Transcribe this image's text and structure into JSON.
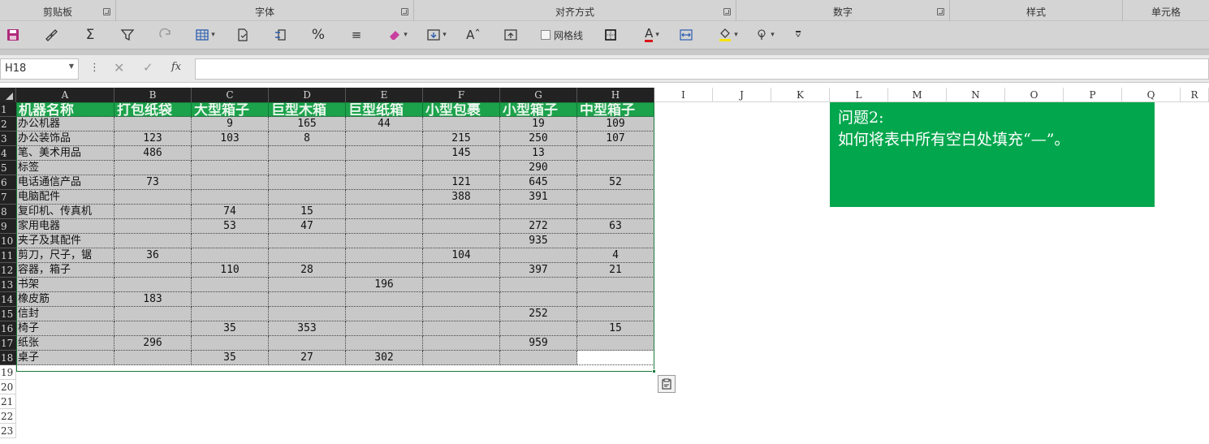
{
  "ribbon": {
    "groups": [
      {
        "label": "剪贴板"
      },
      {
        "label": "字体"
      },
      {
        "label": "对齐方式"
      },
      {
        "label": "数字"
      },
      {
        "label": "样式"
      },
      {
        "label": "单元格"
      }
    ],
    "toolbar": {
      "gridlines_label": "网格线"
    }
  },
  "formula_bar": {
    "name_box": "H18",
    "fx_label": "fx",
    "content": ""
  },
  "sheet": {
    "column_headers": [
      "A",
      "B",
      "C",
      "D",
      "E",
      "F",
      "G",
      "H",
      "I",
      "J",
      "K",
      "L",
      "M",
      "N",
      "O",
      "P",
      "Q",
      "R"
    ],
    "row_headers": [
      "1",
      "2",
      "3",
      "4",
      "5",
      "6",
      "7",
      "8",
      "9",
      "10",
      "11",
      "12",
      "13",
      "14",
      "15",
      "16",
      "17",
      "18",
      "19",
      "20",
      "21",
      "22",
      "23"
    ],
    "header_row": [
      "机器名称",
      "打包纸袋",
      "大型箱子",
      "巨型木箱",
      "巨型纸箱",
      "小型包裹",
      "小型箱子",
      "中型箱子"
    ],
    "rows": [
      [
        "办公机器",
        "",
        "9",
        "165",
        "44",
        "",
        "19",
        "109"
      ],
      [
        "办公装饰品",
        "123",
        "103",
        "8",
        "",
        "215",
        "250",
        "107"
      ],
      [
        "笔、美术用品",
        "486",
        "",
        "",
        "",
        "145",
        "13",
        ""
      ],
      [
        "标签",
        "",
        "",
        "",
        "",
        "",
        "290",
        ""
      ],
      [
        "电话通信产品",
        "73",
        "",
        "",
        "",
        "121",
        "645",
        "52"
      ],
      [
        "电脑配件",
        "",
        "",
        "",
        "",
        "388",
        "391",
        ""
      ],
      [
        "复印机、传真机",
        "",
        "74",
        "15",
        "",
        "",
        "",
        ""
      ],
      [
        "家用电器",
        "",
        "53",
        "47",
        "",
        "",
        "272",
        "63"
      ],
      [
        "夹子及其配件",
        "",
        "",
        "",
        "",
        "",
        "935",
        ""
      ],
      [
        "剪刀，尺子，锯",
        "36",
        "",
        "",
        "",
        "104",
        "",
        "4"
      ],
      [
        "容器，箱子",
        "",
        "110",
        "28",
        "",
        "",
        "397",
        "21"
      ],
      [
        "书架",
        "",
        "",
        "",
        "196",
        "",
        "",
        ""
      ],
      [
        "橡皮筋",
        "183",
        "",
        "",
        "",
        "",
        "",
        ""
      ],
      [
        "信封",
        "",
        "",
        "",
        "",
        "",
        "252",
        ""
      ],
      [
        "椅子",
        "",
        "35",
        "353",
        "",
        "",
        "",
        "15"
      ],
      [
        "纸张",
        "296",
        "",
        "",
        "",
        "",
        "959",
        ""
      ],
      [
        "桌子",
        "",
        "35",
        "27",
        "302",
        "",
        "",
        ""
      ]
    ]
  },
  "note": {
    "title": "问题2:",
    "text": "如何将表中所有空白处填充“—”。"
  },
  "colors": {
    "header_green": "#1ba24b",
    "note_green": "#02a74d",
    "selection_grey": "#c8c8c8"
  }
}
